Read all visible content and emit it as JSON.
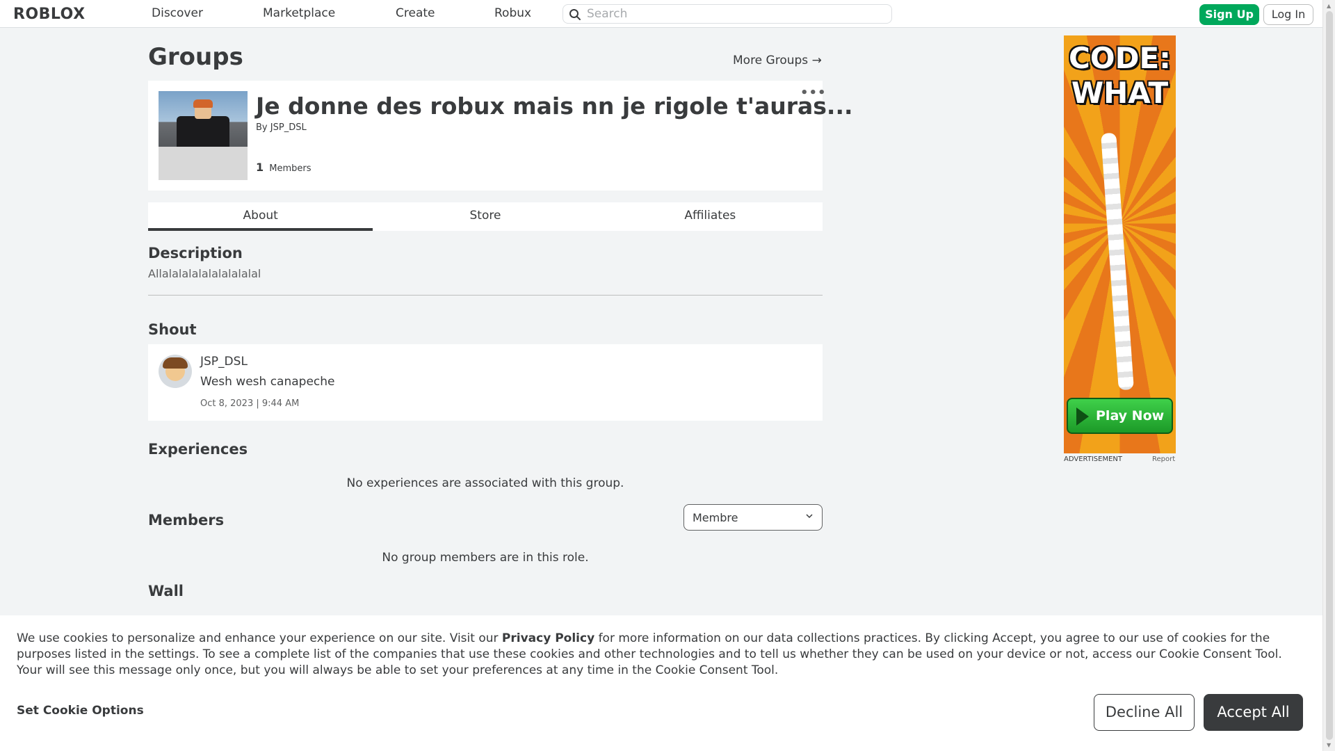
{
  "nav": {
    "logo": "ROBLOX",
    "links": [
      "Discover",
      "Marketplace",
      "Create",
      "Robux"
    ],
    "search_placeholder": "Search",
    "signup_label": "Sign Up",
    "login_label": "Log In"
  },
  "page": {
    "title": "Groups",
    "more_groups": "More Groups →"
  },
  "group": {
    "name": "Je donne des robux mais nn je rigole t'auras...",
    "by_label": "By",
    "owner": "JSP_DSL",
    "member_count": "1",
    "members_label": "Members",
    "more_options": "•••"
  },
  "tabs": [
    "About",
    "Store",
    "Affiliates"
  ],
  "description": {
    "title": "Description",
    "text": "Allalalalalalalalalalal"
  },
  "shout": {
    "title": "Shout",
    "user": "JSP_DSL",
    "message": "Wesh wesh canapeche",
    "date": "Oct 8, 2023 | 9:44 AM"
  },
  "experiences": {
    "title": "Experiences",
    "empty": "No experiences are associated with this group."
  },
  "members": {
    "title": "Members",
    "role_selected": "Membre",
    "empty": "No group members are in this role."
  },
  "wall": {
    "title": "Wall"
  },
  "ad": {
    "headline": "CODE: WHAT",
    "cta": "Play Now",
    "label": "ADVERTISEMENT",
    "report": "Report"
  },
  "cookie": {
    "text_before": "We use cookies to personalize and enhance your experience on our site. Visit our ",
    "privacy_link": "Privacy Policy",
    "text_after": " for more information on our data collections practices. By clicking Accept, you agree to our use of cookies for the purposes listed in the settings. To see a complete list of the companies that use these cookies and other technologies and to tell us whether they can be used on your device or not, access our Cookie Consent Tool. Your will see this message only once, but you will always be able to set your preferences at any time in the Cookie Consent Tool.",
    "options_label": "Set Cookie Options",
    "decline_label": "Decline All",
    "accept_label": "Accept All"
  },
  "colors": {
    "accent_green": "#00a85b",
    "text_dark": "#393b3d",
    "background": "#f2f4f5"
  }
}
